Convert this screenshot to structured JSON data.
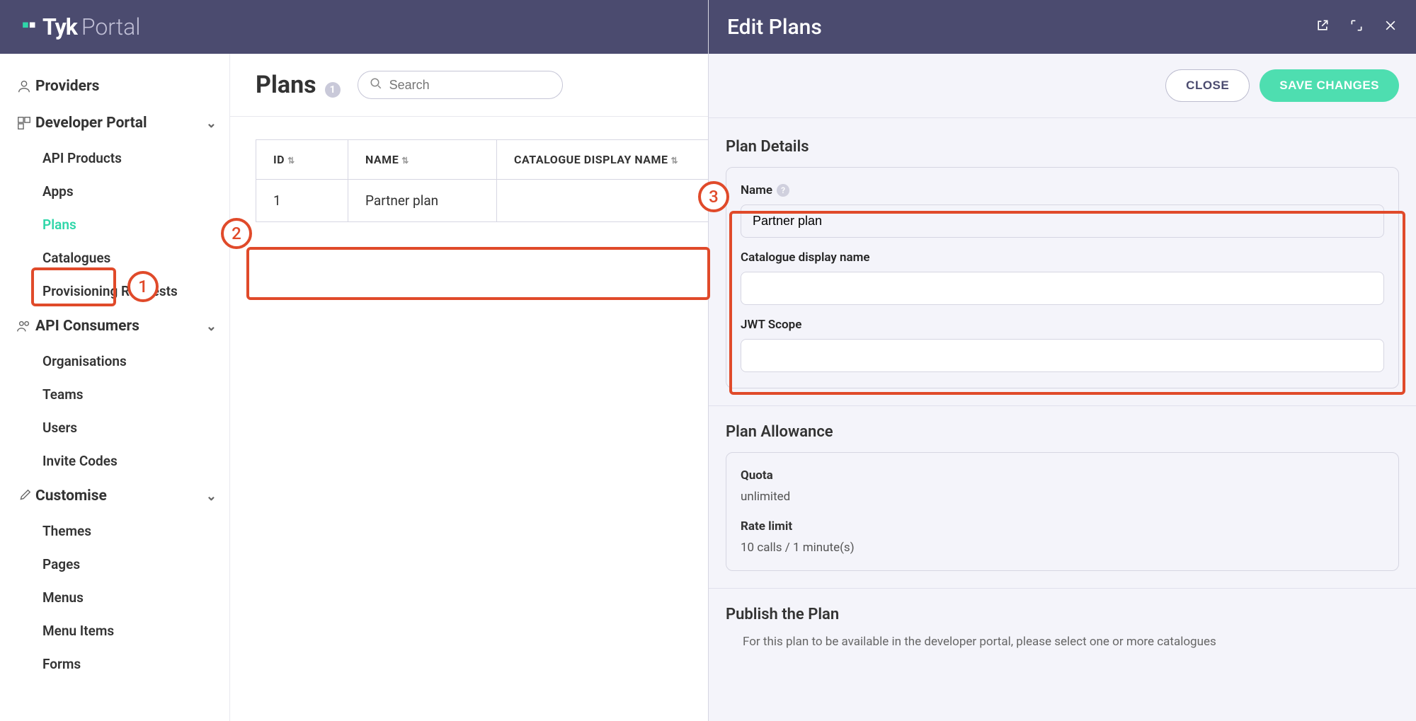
{
  "app": {
    "logo_text": "Tyk",
    "logo_sub": "Portal"
  },
  "sidebar": {
    "providers": "Providers",
    "dev_portal": "Developer Portal",
    "dev_items": [
      "API Products",
      "Apps",
      "Plans",
      "Catalogues",
      "Provisioning Requests"
    ],
    "api_consumers": "API Consumers",
    "api_items": [
      "Organisations",
      "Teams",
      "Users",
      "Invite Codes"
    ],
    "customise": "Customise",
    "customise_items": [
      "Themes",
      "Pages",
      "Menus",
      "Menu Items",
      "Forms"
    ]
  },
  "page": {
    "title": "Plans",
    "count": "1",
    "search_placeholder": "Search"
  },
  "table": {
    "headers": [
      "ID",
      "NAME",
      "CATALOGUE DISPLAY NAME"
    ],
    "rows": [
      {
        "id": "1",
        "name": "Partner plan",
        "catalogue": ""
      }
    ]
  },
  "overlay": {
    "title": "Edit Plans",
    "close_btn": "CLOSE",
    "save_btn": "SAVE CHANGES",
    "section_details": "Plan Details",
    "label_name": "Name",
    "name_value": "Partner plan",
    "label_catalogue": "Catalogue display name",
    "catalogue_value": "",
    "label_jwt": "JWT Scope",
    "jwt_value": "",
    "section_allowance": "Plan Allowance",
    "quota_label": "Quota",
    "quota_value": "unlimited",
    "rate_label": "Rate limit",
    "rate_value": "10 calls / 1 minute(s)",
    "section_publish": "Publish the Plan",
    "publish_desc": "For this plan to be available in the developer portal, please select one or more catalogues"
  },
  "annotations": {
    "n1": "1",
    "n2": "2",
    "n3": "3"
  }
}
